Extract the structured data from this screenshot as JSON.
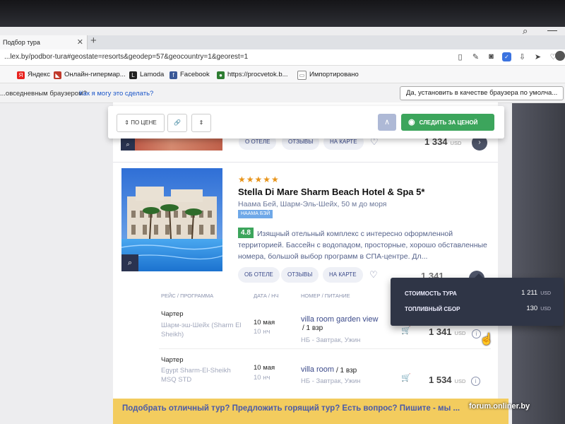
{
  "browser": {
    "tab_title": "Подбор тура",
    "url": "...lex.by/podbor-tura#geostate=resorts&geodep=57&geocountry=1&georest=1",
    "bookmarks": [
      "Яндекс",
      "Онлайн-гипермар...",
      "Lamoda",
      "Facebook",
      "https://procvetok.b...",
      "Импортировано"
    ],
    "infobar": {
      "question": "...овседневным браузером?",
      "link": "Как я могу это сделать?",
      "button": "Да, установить в качестве браузера по умолча..."
    }
  },
  "toolbar": {
    "sort_label": "ПО ЦЕНЕ",
    "track_label": "СЛЕДИТЬ ЗА ЦЕНОЙ"
  },
  "prev_hotel": {
    "actions": [
      "О ОТЕЛЕ",
      "ОТЗЫВЫ",
      "НА КАРТЕ"
    ],
    "price": "1 334",
    "currency": "USD"
  },
  "hotel": {
    "stars": "★★★★★",
    "name": "Stella Di Mare Sharm Beach Hotel & Spa 5*",
    "location": "Наама Бей, Шарм-Эль-Шейх, 50 м до моря",
    "tag": "НААМА БЭЙ",
    "rating": "4.8",
    "description": "Изящный отельный комплекс с интересно оформленной территорией. Бассейн с водопадом, просторные, хорошо обставленные номера, большой выбор программ в СПА-центре. Дл...",
    "actions": [
      "ОБ ОТЕЛЕ",
      "ОТЗЫВЫ",
      "НА КАРТЕ"
    ],
    "price": "1 341"
  },
  "table": {
    "headers": [
      "РЕЙС / ПРОГРАММА",
      "ДАТА / НЧ",
      "НОМЕР / ПИТАНИЕ"
    ],
    "rows": [
      {
        "type": "Чартер",
        "route": "Шарм-эш-Шейх (Sharm El",
        "route2": "Sheikh)",
        "date": "10 мая",
        "nights": "10 нч",
        "room": "villa room garden view",
        "room2": "/ 1 взр",
        "meal": "НБ - Завтрак, Ужин",
        "price": "1 341",
        "currency": "USD"
      },
      {
        "type": "Чартер",
        "route": "Egypt Sharm-El-Sheikh",
        "route2": "MSQ STD",
        "date": "10 мая",
        "nights": "10 нч",
        "room": "villa room",
        "room2": "/ 1 взр",
        "meal": "НБ - Завтрак, Ужин",
        "price": "1 534",
        "currency": "USD"
      }
    ]
  },
  "tooltip": {
    "tour_label": "СТОИМОСТЬ ТУРА",
    "tour_value": "1 211",
    "fuel_label": "ТОПЛИВНЫЙ СБОР",
    "fuel_value": "130",
    "currency": "USD"
  },
  "banner": "Подобрать отличный тур? Предложить горящий тур? Есть вопрос? Пишите - мы ...",
  "watermark": "forum.onliner.by"
}
